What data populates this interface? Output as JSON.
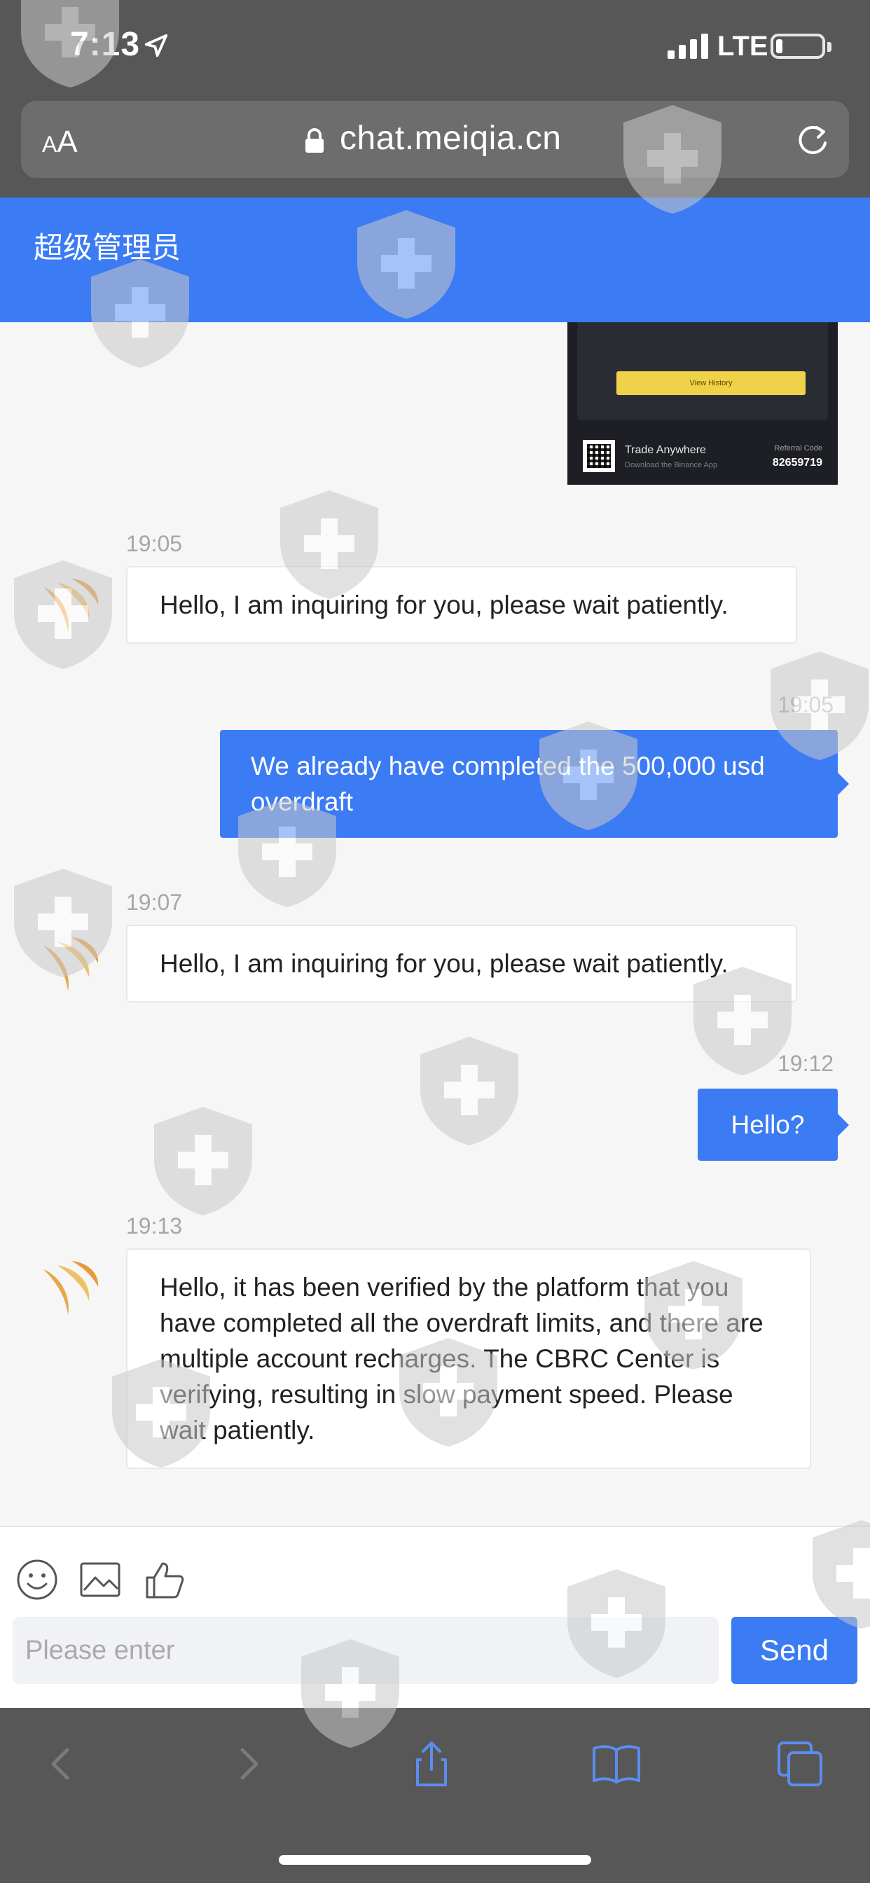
{
  "status_bar": {
    "time": "7:13",
    "carrier": "LTE",
    "battery_level": 0.15
  },
  "browser": {
    "text_size_label_small": "A",
    "text_size_label_large": "A",
    "url": "chat.meiqia.cn"
  },
  "chat": {
    "title": "超级管理员"
  },
  "shared_image": {
    "button_label": "View History",
    "trade_label": "Trade Anywhere",
    "download_label": "Download the Binance App",
    "referral_label": "Referral Code",
    "referral_code": "82659719"
  },
  "messages": [
    {
      "direction": "in",
      "time": "19:05",
      "text": "Hello, I am inquiring for you, please wait patiently."
    },
    {
      "direction": "out",
      "time": "19:05",
      "text": "We already have completed the 500,000 usd overdraft"
    },
    {
      "direction": "in",
      "time": "19:07",
      "text": "Hello, I am inquiring for you, please wait patiently."
    },
    {
      "direction": "out",
      "time": "19:12",
      "text": "Hello?"
    },
    {
      "direction": "in",
      "time": "19:13",
      "text": "Hello, it has been verified by the platform that you have completed all the overdraft limits, and there are multiple account recharges. The CBRC Center is verifying, resulting in slow payment speed. Please wait patiently."
    }
  ],
  "composer": {
    "placeholder": "Please enter",
    "send_label": "Send"
  },
  "colors": {
    "accent": "#3b7bf3",
    "chrome": "#575757",
    "browser_icons": "#5b8def"
  }
}
